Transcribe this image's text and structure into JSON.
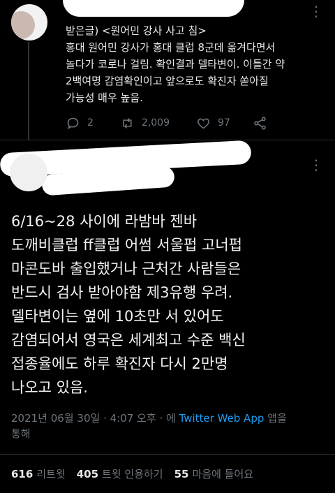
{
  "tweet_top": {
    "lines": [
      "받은글) <원어민 강사 사고 침>",
      "홍대 원어민 강사가 홍대 클럽  8군데 옮겨다면서",
      "놀다가 코로나 걸림. 확인결과 델타변이. 이틀간 약",
      "2백여명 감염확인이고 앞으로도 확진자 쏟아질",
      "가능성 매우 높음."
    ],
    "replies": "2",
    "retweets": "2,009",
    "likes": "97"
  },
  "tweet_main": {
    "lines": [
      "6/16~28 사이에 라밤바 젠바",
      "도깨비클럽  ff클럽 어썸 서울펍 고너펍",
      "마콘도바 출입했거나 근처간 사람들은",
      "반드시 검사 받아야함 제3유행 우려.",
      "델타변이는 옆에 10초만 서 있어도",
      "감염되어서 영국은 세계최고 수준 백신",
      "접종율에도 하루 확진자 다시 2만명",
      "나오고 있음."
    ],
    "date": "2021년 06월 30일",
    "dot1": " · ",
    "time": "4:07 오후",
    "dot2": " · 에 ",
    "source": "Twitter Web App",
    "source_suffix": " 앱을",
    "source_suffix2": "통해"
  },
  "stats": {
    "retweets_count": "616",
    "retweets_label": "리트윗",
    "quotes_count": "405",
    "quotes_label": "트윗 인용하기",
    "likes_count": "55",
    "likes_label": "마음에 들어요"
  },
  "icons": [
    "reply-icon",
    "retweet-icon",
    "like-icon",
    "share-icon",
    "more-icon"
  ]
}
